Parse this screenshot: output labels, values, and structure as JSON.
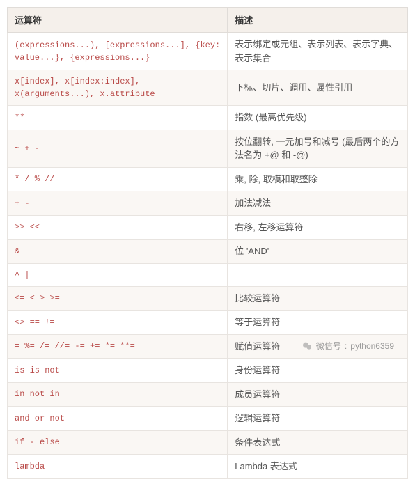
{
  "headers": {
    "operator": "运算符",
    "description": "描述"
  },
  "rows": [
    {
      "op": "(expressions...), [expressions...], {key: value...}, {expressions...}",
      "desc": "表示绑定或元组、表示列表、表示字典、表示集合"
    },
    {
      "op": "x[index], x[index:index], x(arguments...), x.attribute",
      "desc": "下标、切片、调用、属性引用"
    },
    {
      "op": "**",
      "desc": "指数 (最高优先级)"
    },
    {
      "op": "~ + -",
      "desc": "按位翻转, 一元加号和减号 (最后两个的方法名为 +@ 和 -@)"
    },
    {
      "op": "* / % //",
      "desc": "乘, 除, 取模和取整除"
    },
    {
      "op": "+ -",
      "desc": "加法减法"
    },
    {
      "op": ">> <<",
      "desc": "右移, 左移运算符"
    },
    {
      "op": "&",
      "desc": "位 'AND'"
    },
    {
      "op": "^ |",
      "desc": ""
    },
    {
      "op": "<= < > >=",
      "desc": "比较运算符"
    },
    {
      "op": "<> == !=",
      "desc": "等于运算符"
    },
    {
      "op": "= %= /= //= -= += *= **=",
      "desc": "赋值运算符"
    },
    {
      "op": "is is not",
      "desc": "身份运算符"
    },
    {
      "op": "in not in",
      "desc": "成员运算符"
    },
    {
      "op": "and or not",
      "desc": "逻辑运算符"
    },
    {
      "op": "if - else",
      "desc": "条件表达式"
    },
    {
      "op": "lambda",
      "desc": "Lambda 表达式"
    }
  ],
  "watermark": {
    "label": "微信号",
    "value": "python6359"
  }
}
